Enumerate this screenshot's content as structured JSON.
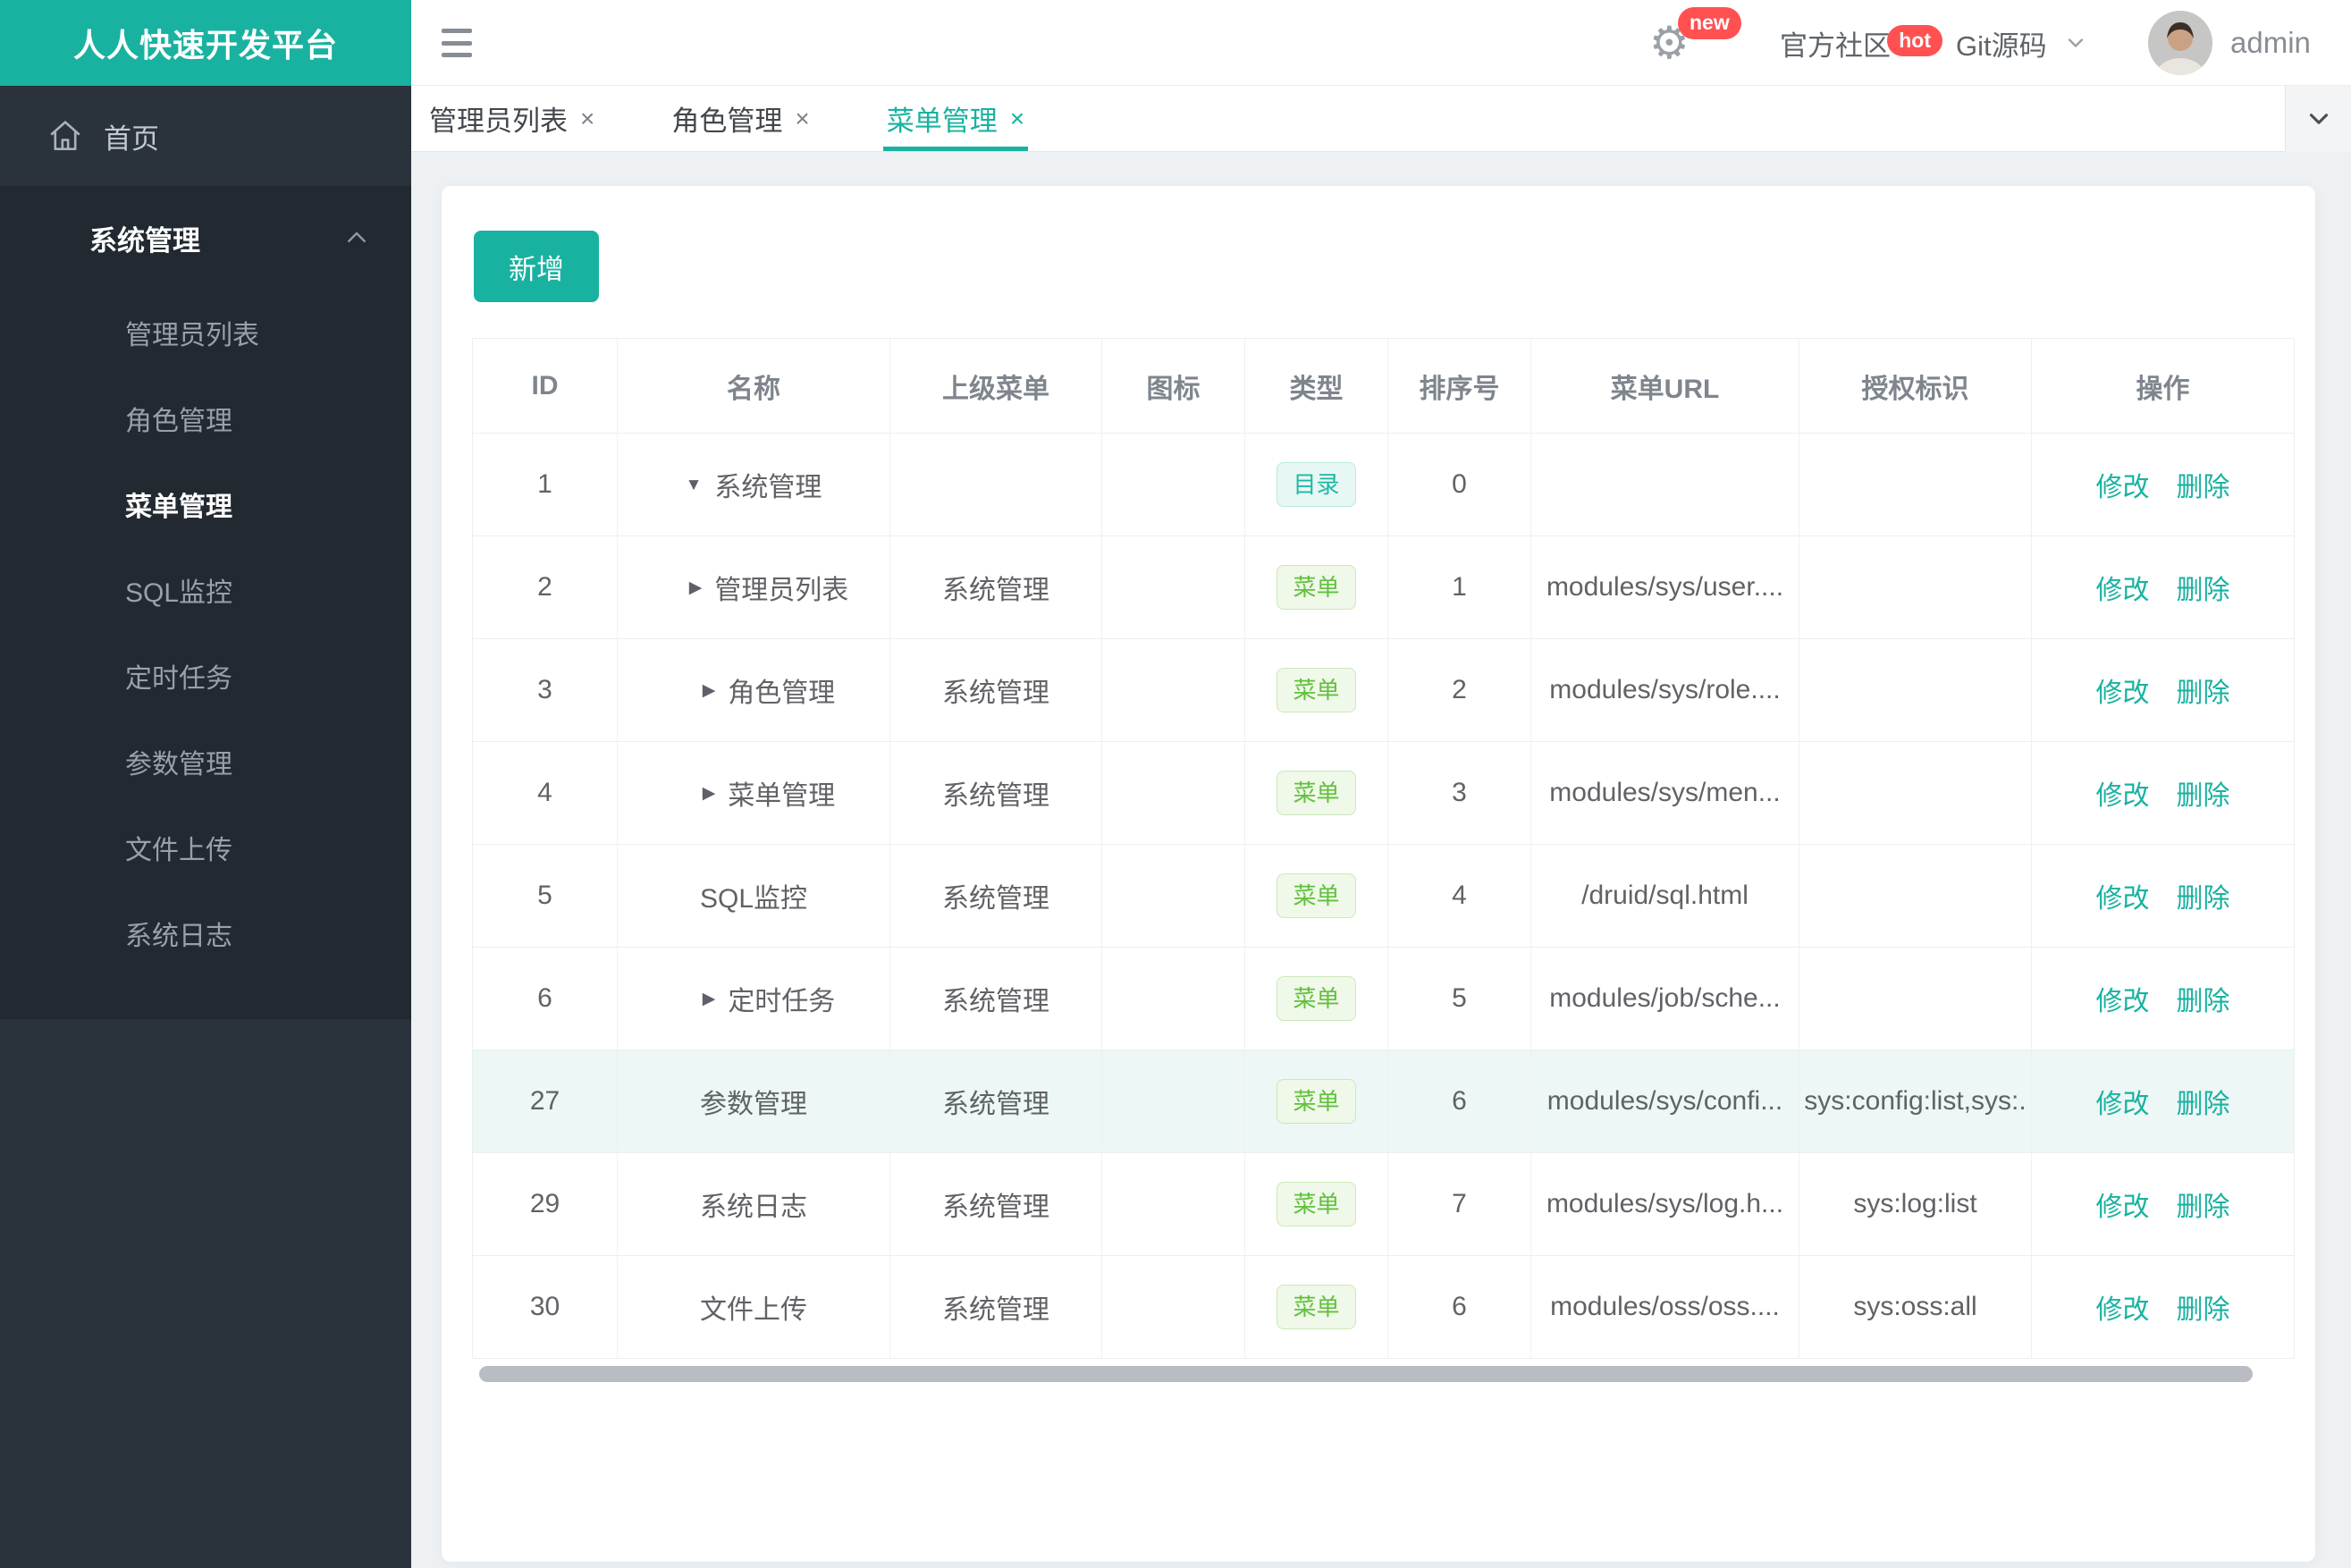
{
  "app": {
    "logo_title": "人人快速开发平台"
  },
  "colors": {
    "accent": "#19b2a0",
    "sidebar_bg": "#2a323b",
    "sidebar_group_bg": "#222930",
    "badge_catalog_text": "#1fb8a6",
    "badge_menu_text": "#61c13c",
    "notice_red": "#ff5152",
    "row_highlight": "#edf7f5"
  },
  "header": {
    "badge_new": "new",
    "community_label": "官方社区",
    "badge_hot": "hot",
    "git_label": "Git源码",
    "username": "admin"
  },
  "tabs": [
    {
      "label": "管理员列表",
      "close": "×",
      "active": false
    },
    {
      "label": "角色管理",
      "close": "×",
      "active": false
    },
    {
      "label": "菜单管理",
      "close": "×",
      "active": true
    }
  ],
  "sidebar": {
    "home_label": "首页",
    "group_label": "系统管理",
    "items": [
      {
        "label": "管理员列表",
        "active": false
      },
      {
        "label": "角色管理",
        "active": false
      },
      {
        "label": "菜单管理",
        "active": true
      },
      {
        "label": "SQL监控",
        "active": false
      },
      {
        "label": "定时任务",
        "active": false
      },
      {
        "label": "参数管理",
        "active": false
      },
      {
        "label": "文件上传",
        "active": false
      },
      {
        "label": "系统日志",
        "active": false
      }
    ]
  },
  "toolbar": {
    "add_label": "新增"
  },
  "table": {
    "columns": [
      "ID",
      "名称",
      "上级菜单",
      "图标",
      "类型",
      "排序号",
      "菜单URL",
      "授权标识",
      "操作"
    ],
    "actions": {
      "edit": "修改",
      "delete": "删除"
    },
    "rows": [
      {
        "id": "1",
        "arrow": "down",
        "indent": 0,
        "name": "系统管理",
        "parent": "",
        "type": "目录",
        "variant": "catalog",
        "order": "0",
        "url": "",
        "perms": "",
        "highlighted": false
      },
      {
        "id": "2",
        "arrow": "right",
        "indent": 1,
        "name": "管理员列表",
        "parent": "系统管理",
        "type": "菜单",
        "variant": "menu",
        "order": "1",
        "url": "modules/sys/user....",
        "perms": "",
        "highlighted": false
      },
      {
        "id": "3",
        "arrow": "right",
        "indent": 1,
        "name": "角色管理",
        "parent": "系统管理",
        "type": "菜单",
        "variant": "menu",
        "order": "2",
        "url": "modules/sys/role....",
        "perms": "",
        "highlighted": false
      },
      {
        "id": "4",
        "arrow": "right",
        "indent": 1,
        "name": "菜单管理",
        "parent": "系统管理",
        "type": "菜单",
        "variant": "menu",
        "order": "3",
        "url": "modules/sys/men...",
        "perms": "",
        "highlighted": false
      },
      {
        "id": "5",
        "arrow": "none",
        "indent": 0,
        "name": "SQL监控",
        "parent": "系统管理",
        "type": "菜单",
        "variant": "menu",
        "order": "4",
        "url": "/druid/sql.html",
        "perms": "",
        "highlighted": false
      },
      {
        "id": "6",
        "arrow": "right",
        "indent": 1,
        "name": "定时任务",
        "parent": "系统管理",
        "type": "菜单",
        "variant": "menu",
        "order": "5",
        "url": "modules/job/sche...",
        "perms": "",
        "highlighted": false
      },
      {
        "id": "27",
        "arrow": "none",
        "indent": 0,
        "name": "参数管理",
        "parent": "系统管理",
        "type": "菜单",
        "variant": "menu",
        "order": "6",
        "url": "modules/sys/confi...",
        "perms": "sys:config:list,sys:.",
        "highlighted": true
      },
      {
        "id": "29",
        "arrow": "none",
        "indent": 0,
        "name": "系统日志",
        "parent": "系统管理",
        "type": "菜单",
        "variant": "menu",
        "order": "7",
        "url": "modules/sys/log.h...",
        "perms": "sys:log:list",
        "highlighted": false
      },
      {
        "id": "30",
        "arrow": "none",
        "indent": 0,
        "name": "文件上传",
        "parent": "系统管理",
        "type": "菜单",
        "variant": "menu",
        "order": "6",
        "url": "modules/oss/oss....",
        "perms": "sys:oss:all",
        "highlighted": false
      }
    ]
  }
}
